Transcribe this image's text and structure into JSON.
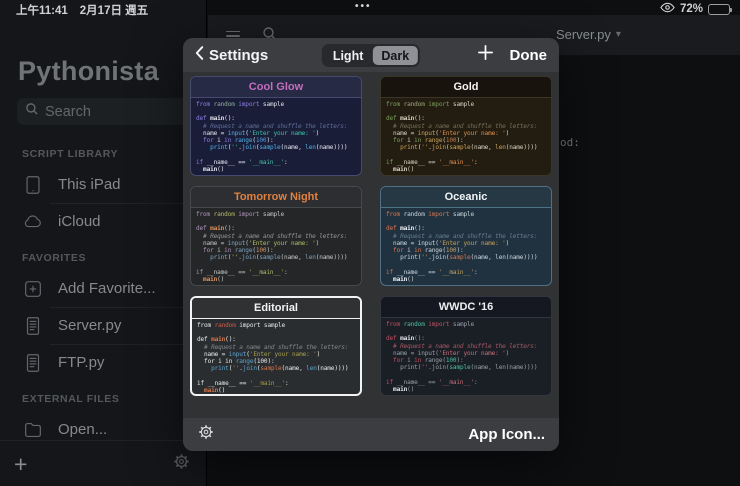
{
  "status_bar": {
    "time": "上午11:41",
    "date": "2月17日 週五",
    "battery_percent": "72%",
    "battery_level": 72,
    "multitask_dots": "•••"
  },
  "sidebar": {
    "app_title": "Pythonista",
    "search_placeholder": "Search",
    "sections": [
      {
        "header": "SCRIPT LIBRARY",
        "items": [
          {
            "label": "This iPad",
            "icon": "ipad-icon"
          },
          {
            "label": "iCloud",
            "icon": "cloud-icon"
          }
        ]
      },
      {
        "header": "FAVORITES",
        "items": [
          {
            "label": "Add Favorite...",
            "icon": "add-favorite-icon"
          },
          {
            "label": "Server.py",
            "icon": "script-file-icon"
          },
          {
            "label": "FTP.py",
            "icon": "script-file-icon"
          }
        ]
      },
      {
        "header": "EXTERNAL FILES",
        "items": [
          {
            "label": "Open...",
            "icon": "folder-icon"
          }
        ]
      }
    ]
  },
  "editor": {
    "open_file": "Server.py",
    "visible_code_fragment": "od:"
  },
  "settings_modal": {
    "title": "Settings",
    "appearance_segments": [
      "Light",
      "Dark"
    ],
    "selected_segment": "Dark",
    "done_label": "Done",
    "app_icon_label": "App Icon...",
    "sample_code_text": "from random import sample\n\ndef main():\n  # Request a name and shuffle the letters:\n  name = input('Enter your name: ')\n  for i in range(100):\n    print(''.join(sample(name, len(name))))\n\nif __name__ == '__main__':\n  main()",
    "code_tokens": [
      [
        [
          "k",
          "from"
        ],
        [
          "d",
          " "
        ],
        [
          "n",
          "random"
        ],
        [
          "d",
          " "
        ],
        [
          "k",
          "import"
        ],
        [
          "d",
          " "
        ],
        [
          "d",
          "sample"
        ]
      ],
      [],
      [
        [
          "k",
          "def"
        ],
        [
          "d",
          " "
        ],
        [
          "f",
          "main"
        ],
        [
          "d",
          "():"
        ]
      ],
      [
        [
          "d",
          "  "
        ],
        [
          "c",
          "# Request a name and shuffle the letters:"
        ]
      ],
      [
        [
          "d",
          "  name = "
        ],
        [
          "b",
          "input"
        ],
        [
          "d",
          "("
        ],
        [
          "s",
          "'Enter your name: '"
        ],
        [
          "d",
          ")"
        ]
      ],
      [
        [
          "d",
          "  "
        ],
        [
          "k",
          "for"
        ],
        [
          "d",
          " i "
        ],
        [
          "k",
          "in"
        ],
        [
          "d",
          " "
        ],
        [
          "b",
          "range"
        ],
        [
          "d",
          "("
        ],
        [
          "num",
          "100"
        ],
        [
          "d",
          "):"
        ]
      ],
      [
        [
          "d",
          "    "
        ],
        [
          "b",
          "print"
        ],
        [
          "d",
          "("
        ],
        [
          "s",
          "''"
        ],
        [
          "d",
          "."
        ],
        [
          "b",
          "join"
        ],
        [
          "d",
          "("
        ],
        [
          "f2",
          "sample"
        ],
        [
          "d",
          "(name, "
        ],
        [
          "b",
          "len"
        ],
        [
          "d",
          "(name))))"
        ]
      ],
      [],
      [
        [
          "k",
          "if"
        ],
        [
          "d",
          " __name__ == "
        ],
        [
          "s",
          "'__main__'"
        ],
        [
          "d",
          ":"
        ]
      ],
      [
        [
          "d",
          "  "
        ],
        [
          "f",
          "main"
        ],
        [
          "d",
          "()"
        ]
      ]
    ],
    "themes": [
      {
        "name": "Cool Glow",
        "selected": false,
        "colors": {
          "border": "#454a6e",
          "header_bg": "#262a45",
          "title": "#c56dbd",
          "body_bg": "#1a1d37",
          "keyword": "#8b7de2",
          "default": "#e4e5f1",
          "comment": "#5d6f9a",
          "string": "#3fc4a7",
          "builtin": "#4fb1e8",
          "function": "#e4e5f1",
          "number": "#4f9ce8",
          "module": "#8fb0a0",
          "call": "#4fb1e8"
        }
      },
      {
        "name": "Gold",
        "selected": false,
        "colors": {
          "border": "#3b3526",
          "header_bg": "#18140d",
          "title": "#f5f4ef",
          "body_bg": "#221c11",
          "keyword": "#7ba25c",
          "default": "#dcd5c2",
          "comment": "#78715b",
          "string": "#e1914c",
          "builtin": "#d0a455",
          "function": "#dcd5c2",
          "number": "#c87d4c",
          "module": "#a2aa7c",
          "call": "#d0a455"
        }
      },
      {
        "name": "Tomorrow Night",
        "selected": false,
        "colors": {
          "border": "#45484d",
          "header_bg": "#2c2e31",
          "title": "#e08140",
          "body_bg": "#242628",
          "keyword": "#b294bb",
          "default": "#c5c8c6",
          "comment": "#969896",
          "string": "#b5bd68",
          "builtin": "#81a2be",
          "function": "#de935f",
          "number": "#de935f",
          "module": "#b5bd68",
          "call": "#81a2be"
        }
      },
      {
        "name": "Oceanic",
        "selected": false,
        "colors": {
          "border": "#4f7188",
          "header_bg": "#263844",
          "title": "#f0f4f6",
          "body_bg": "#203140",
          "keyword": "#d7764c",
          "default": "#ccd7dd",
          "comment": "#64808f",
          "string": "#c9a358",
          "builtin": "#ccd7dd",
          "function": "#f2f5f7",
          "number": "#c9a358",
          "module": "#ccd7dd",
          "call": "#d7764c"
        }
      },
      {
        "name": "Editorial",
        "selected": true,
        "colors": {
          "border": "#f2f3f4",
          "header_bg": "#2f3133",
          "title": "#f2f3f4",
          "body_bg": "#2a2d2f",
          "keyword": "#e9e9e9",
          "default": "#e9e9e9",
          "comment": "#85888b",
          "string": "#a79f50",
          "builtin": "#5ba4d0",
          "function": "#d7764c",
          "number": "#e9e9e9",
          "module": "#d15b49",
          "call": "#d7764c"
        }
      },
      {
        "name": "WWDC '16",
        "selected": false,
        "colors": {
          "border": "#31353f",
          "header_bg": "#151820",
          "title": "#edeff2",
          "body_bg": "#1a1e25",
          "keyword": "#c1505f",
          "default": "#99a0a9",
          "comment": "#a95964",
          "string": "#c76f7d",
          "builtin": "#99a0a9",
          "function": "#e5e8eb",
          "number": "#4cc1a3",
          "module": "#4cc1a3",
          "call": "#4cc1a3"
        }
      }
    ]
  }
}
